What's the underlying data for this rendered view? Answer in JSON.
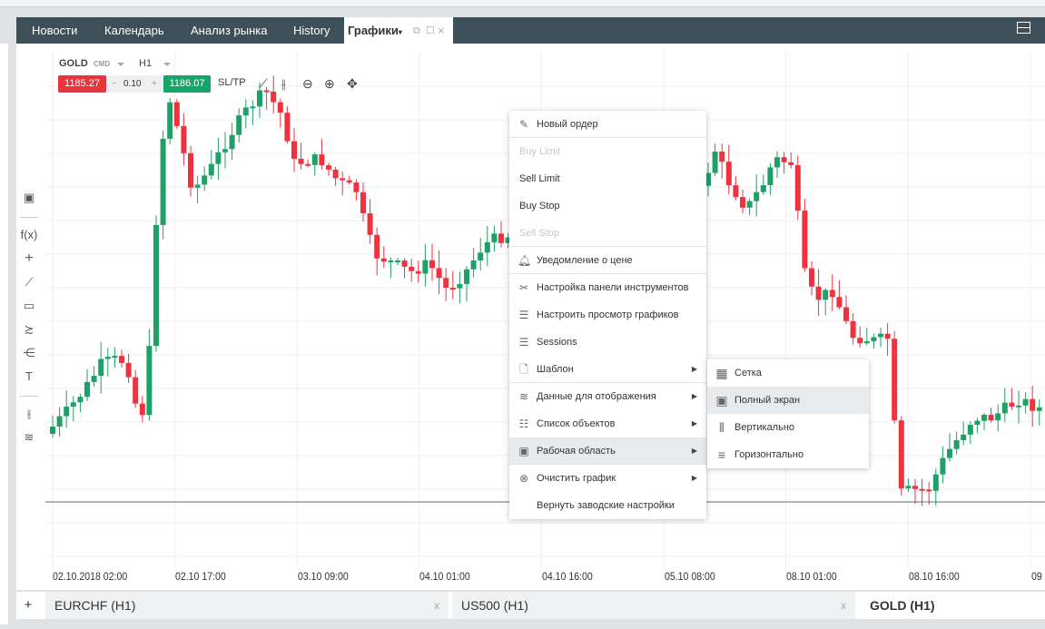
{
  "tabs": [
    {
      "label": "Новости"
    },
    {
      "label": "Календарь"
    },
    {
      "label": "Анализ рынка"
    },
    {
      "label": "History"
    },
    {
      "label": "Графики"
    }
  ],
  "chart_header": {
    "symbol": "GOLD",
    "symbol_type": "CMD",
    "timeframe": "H1",
    "sell_price": "1185.27",
    "lot": "0.10",
    "minus": "−",
    "plus": "+",
    "buy_price": "1186.07",
    "sltp": "SL/TP"
  },
  "colors": {
    "up": "#1fa068",
    "down": "#f0323f",
    "tabbar": "#3d4f58",
    "sell": "#e8353d",
    "buy": "#17a66a"
  },
  "x_labels": [
    "02.10.2018 02:00",
    "02.10 17:00",
    "03.10 09:00",
    "04.10 01:00",
    "04.10 16:00",
    "05.10 08:00",
    "08.10 01:00",
    "08.10 16:00",
    "09"
  ],
  "context_menu": [
    {
      "label": "Новый ордер",
      "icon": "edit-icon"
    },
    {
      "label": "Buy Limit",
      "disabled": true
    },
    {
      "label": "Sell Limit"
    },
    {
      "label": "Buy Stop"
    },
    {
      "label": "Sell Stop",
      "disabled": true
    },
    {
      "label": "Уведомление о цене",
      "icon": "bell-icon"
    },
    {
      "label": "Настройка панели инструментов",
      "icon": "tools-icon"
    },
    {
      "label": "Настроить просмотр графиков",
      "icon": "sliders-icon"
    },
    {
      "label": "Sessions",
      "icon": "sliders-icon"
    },
    {
      "label": "Шаблон",
      "icon": "document-icon",
      "submenu": true
    },
    {
      "label": "Данные для отображения",
      "icon": "layers-icon",
      "submenu": true
    },
    {
      "label": "Список объектов",
      "icon": "list-icon",
      "submenu": true
    },
    {
      "label": "Рабочая область",
      "icon": "workspace-icon",
      "submenu": true,
      "highlighted": true
    },
    {
      "label": "Очистить график",
      "icon": "clear-icon",
      "submenu": true
    },
    {
      "label": "Вернуть заводские настройки"
    }
  ],
  "submenu": [
    {
      "label": "Сетка",
      "icon": "grid-icon"
    },
    {
      "label": "Полный экран",
      "icon": "fullscreen-icon",
      "highlighted": true
    },
    {
      "label": "Вертикально",
      "icon": "vertical-icon"
    },
    {
      "label": "Горизонтально",
      "icon": "horizontal-icon"
    }
  ],
  "bottom_tabs": [
    {
      "label": "EURCHF (H1)"
    },
    {
      "label": "US500 (H1)"
    },
    {
      "label": "GOLD (H1)",
      "active": true
    }
  ],
  "add_tab": "+",
  "close": "x",
  "left_tools": {
    "fx": "f(x)",
    "crosshair": "+",
    "text": "T"
  }
}
